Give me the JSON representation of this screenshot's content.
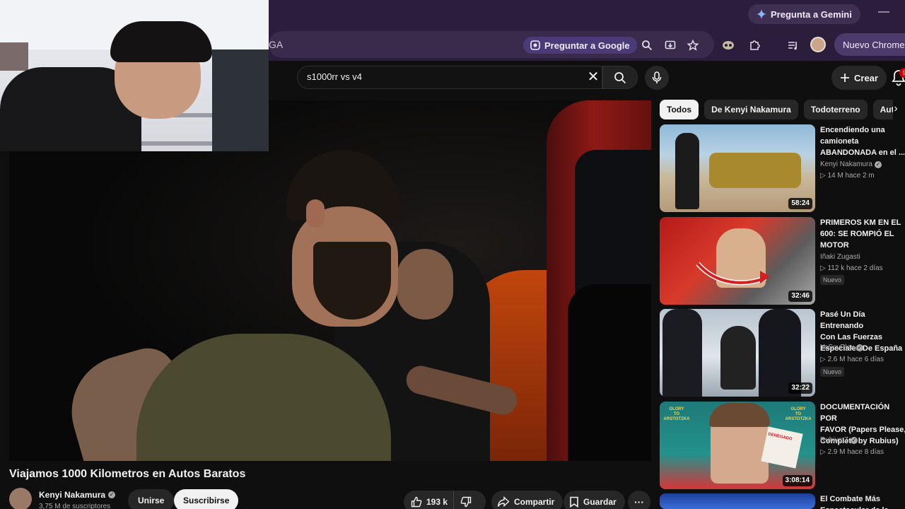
{
  "browser": {
    "gemini_label": "Pregunta a Gemini",
    "minimize": "—",
    "omnibox_text": "GA",
    "ask_google_label": "Preguntar a Google",
    "new_chrome_label": "Nuevo Chrome d"
  },
  "youtube_header": {
    "search_value": "s1000rr vs v4",
    "create_label": "Crear",
    "notif_count": "9"
  },
  "video": {
    "title": "Viajamos 1000 Kilometros en Autos Baratos",
    "channel": "Kenyi Nakamura",
    "subscribers": "3,75 M de suscriptores",
    "join_label": "Unirse",
    "subscribe_label": "Suscribirse",
    "likes": "193 k",
    "share_label": "Compartir",
    "save_label": "Guardar",
    "more_label": "···"
  },
  "chips": [
    "Todos",
    "De Kenyi Nakamura",
    "Todoterreno",
    "Autom"
  ],
  "recommendations": [
    {
      "title": "Encendiendo una\ncamioneta\nABANDONADA en el ...",
      "channel": "Kenyi Nakamura",
      "verified": true,
      "meta": "▷ 14 M  hace 2 m",
      "duration": "58:24",
      "badge": ""
    },
    {
      "title": "PRIMEROS KM EN EL\n600: SE ROMPIÓ EL\nMOTOR",
      "channel": "Iñaki Zugasti",
      "verified": false,
      "meta": "▷ 112 k  hace 2 días",
      "duration": "32:46",
      "badge": "Nuevo"
    },
    {
      "title": "Pasé Un Día Entrenando\nCon Las Fuerzas\nEspeciales De España",
      "channel": "YoSoyPlex",
      "verified": true,
      "meta": "▷ 2.6 M  hace 6 días",
      "duration": "32:22",
      "badge": "Nuevo"
    },
    {
      "title": "DOCUMENTACIÓN POR\nFAVOR (Papers Please,\nCompleto by Rubius)",
      "channel": "Rubius Z",
      "verified": true,
      "meta": "▷ 2.9 M  hace 8 días",
      "duration": "3:08:14",
      "badge": ""
    },
    {
      "title": "El Combate Más\nEspectacular de la",
      "channel": "",
      "verified": false,
      "meta": "",
      "duration": "",
      "badge": ""
    }
  ],
  "thumbnail_text": {
    "glory_left": "GLORY\nTO\nARSTOTZKA",
    "glory_right": "GLORY\nTO\nARSTOTZKA",
    "stamp": "DENEGADO"
  }
}
